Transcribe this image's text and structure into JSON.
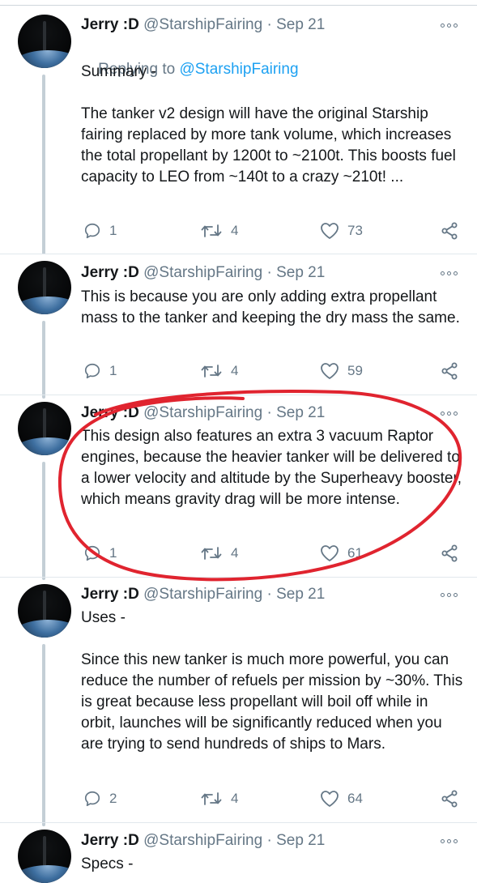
{
  "tweets": [
    {
      "name": "Jerry :D",
      "handle": "@StarshipFairing",
      "date": "· Sep 21",
      "replying_prefix": "Replying to ",
      "replying_handle": "@StarshipFairing",
      "text": "Summary -\n\nThe tanker v2 design will have the original Starship fairing replaced by more tank volume, which increases the total propellant by 1200t to ~2100t. This boosts fuel capacity to LEO from ~140t to a crazy ~210t! ...",
      "replies": "1",
      "retweets": "4",
      "likes": "73"
    },
    {
      "name": "Jerry :D",
      "handle": "@StarshipFairing",
      "date": "· Sep 21",
      "text": "This is because you are only adding extra propellant mass to the tanker and keeping the dry mass the same.",
      "replies": "1",
      "retweets": "4",
      "likes": "59"
    },
    {
      "name": "Jerry :D",
      "handle": "@StarshipFairing",
      "date": "· Sep 21",
      "text": "This design also features an extra 3 vacuum Raptor engines, because the heavier tanker will be delivered to a lower velocity and altitude by the Superheavy booster, which means gravity drag will be more intense.",
      "replies": "1",
      "retweets": "4",
      "likes": "61"
    },
    {
      "name": "Jerry :D",
      "handle": "@StarshipFairing",
      "date": "· Sep 21",
      "text": "Uses -\n\nSince this new tanker is much more powerful, you can reduce the number of refuels per mission by ~30%. This is great because less propellant will boil off while in orbit, launches will be significantly reduced when you are trying to send hundreds of ships to Mars.",
      "replies": "2",
      "retweets": "4",
      "likes": "64"
    },
    {
      "name": "Jerry :D",
      "handle": "@StarshipFairing",
      "date": "· Sep 21",
      "text": "Specs -"
    }
  ],
  "colors": {
    "text": "#14171a",
    "muted": "#657786",
    "link": "#1da1f2",
    "thread_line": "#c4cfd6",
    "annotation": "#e0242f"
  }
}
